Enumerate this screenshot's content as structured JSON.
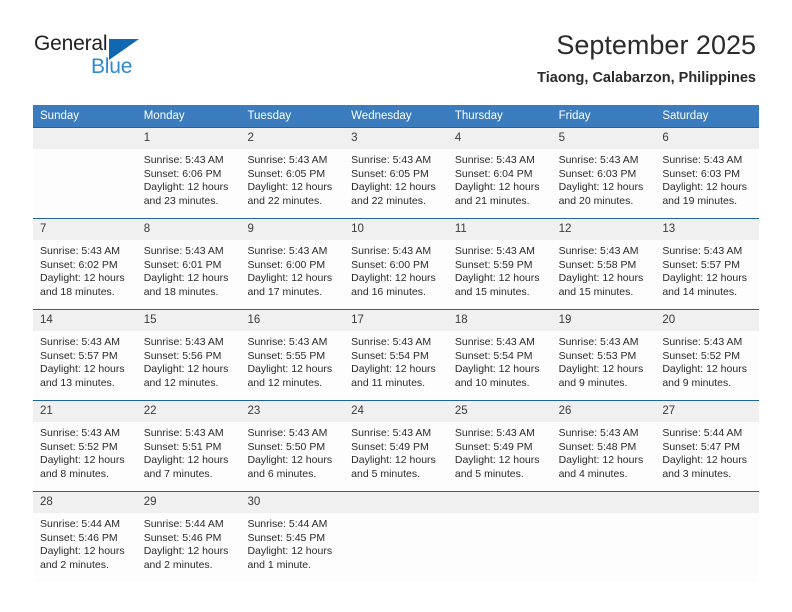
{
  "brand": {
    "name_top": "General",
    "name_bottom": "Blue",
    "triangle_color": "#1167b1",
    "blue_text_color": "#2e8bd4"
  },
  "header": {
    "title": "September 2025",
    "subtitle": "Tiaong, Calabarzon, Philippines"
  },
  "colors": {
    "header_row_bg": "#3b7cbf",
    "header_row_text": "#ffffff",
    "week_divider": "#1f63a4",
    "day_number_band": "#f0f0f0",
    "cell_bg": "#fdfdfd"
  },
  "calendar": {
    "day_headers": [
      "Sunday",
      "Monday",
      "Tuesday",
      "Wednesday",
      "Thursday",
      "Friday",
      "Saturday"
    ],
    "weeks": [
      [
        {
          "day": "",
          "sunrise": "",
          "sunset": "",
          "daylight_line1": "",
          "daylight_line2": ""
        },
        {
          "day": "1",
          "sunrise": "Sunrise: 5:43 AM",
          "sunset": "Sunset: 6:06 PM",
          "daylight_line1": "Daylight: 12 hours",
          "daylight_line2": "and 23 minutes."
        },
        {
          "day": "2",
          "sunrise": "Sunrise: 5:43 AM",
          "sunset": "Sunset: 6:05 PM",
          "daylight_line1": "Daylight: 12 hours",
          "daylight_line2": "and 22 minutes."
        },
        {
          "day": "3",
          "sunrise": "Sunrise: 5:43 AM",
          "sunset": "Sunset: 6:05 PM",
          "daylight_line1": "Daylight: 12 hours",
          "daylight_line2": "and 22 minutes."
        },
        {
          "day": "4",
          "sunrise": "Sunrise: 5:43 AM",
          "sunset": "Sunset: 6:04 PM",
          "daylight_line1": "Daylight: 12 hours",
          "daylight_line2": "and 21 minutes."
        },
        {
          "day": "5",
          "sunrise": "Sunrise: 5:43 AM",
          "sunset": "Sunset: 6:03 PM",
          "daylight_line1": "Daylight: 12 hours",
          "daylight_line2": "and 20 minutes."
        },
        {
          "day": "6",
          "sunrise": "Sunrise: 5:43 AM",
          "sunset": "Sunset: 6:03 PM",
          "daylight_line1": "Daylight: 12 hours",
          "daylight_line2": "and 19 minutes."
        }
      ],
      [
        {
          "day": "7",
          "sunrise": "Sunrise: 5:43 AM",
          "sunset": "Sunset: 6:02 PM",
          "daylight_line1": "Daylight: 12 hours",
          "daylight_line2": "and 18 minutes."
        },
        {
          "day": "8",
          "sunrise": "Sunrise: 5:43 AM",
          "sunset": "Sunset: 6:01 PM",
          "daylight_line1": "Daylight: 12 hours",
          "daylight_line2": "and 18 minutes."
        },
        {
          "day": "9",
          "sunrise": "Sunrise: 5:43 AM",
          "sunset": "Sunset: 6:00 PM",
          "daylight_line1": "Daylight: 12 hours",
          "daylight_line2": "and 17 minutes."
        },
        {
          "day": "10",
          "sunrise": "Sunrise: 5:43 AM",
          "sunset": "Sunset: 6:00 PM",
          "daylight_line1": "Daylight: 12 hours",
          "daylight_line2": "and 16 minutes."
        },
        {
          "day": "11",
          "sunrise": "Sunrise: 5:43 AM",
          "sunset": "Sunset: 5:59 PM",
          "daylight_line1": "Daylight: 12 hours",
          "daylight_line2": "and 15 minutes."
        },
        {
          "day": "12",
          "sunrise": "Sunrise: 5:43 AM",
          "sunset": "Sunset: 5:58 PM",
          "daylight_line1": "Daylight: 12 hours",
          "daylight_line2": "and 15 minutes."
        },
        {
          "day": "13",
          "sunrise": "Sunrise: 5:43 AM",
          "sunset": "Sunset: 5:57 PM",
          "daylight_line1": "Daylight: 12 hours",
          "daylight_line2": "and 14 minutes."
        }
      ],
      [
        {
          "day": "14",
          "sunrise": "Sunrise: 5:43 AM",
          "sunset": "Sunset: 5:57 PM",
          "daylight_line1": "Daylight: 12 hours",
          "daylight_line2": "and 13 minutes."
        },
        {
          "day": "15",
          "sunrise": "Sunrise: 5:43 AM",
          "sunset": "Sunset: 5:56 PM",
          "daylight_line1": "Daylight: 12 hours",
          "daylight_line2": "and 12 minutes."
        },
        {
          "day": "16",
          "sunrise": "Sunrise: 5:43 AM",
          "sunset": "Sunset: 5:55 PM",
          "daylight_line1": "Daylight: 12 hours",
          "daylight_line2": "and 12 minutes."
        },
        {
          "day": "17",
          "sunrise": "Sunrise: 5:43 AM",
          "sunset": "Sunset: 5:54 PM",
          "daylight_line1": "Daylight: 12 hours",
          "daylight_line2": "and 11 minutes."
        },
        {
          "day": "18",
          "sunrise": "Sunrise: 5:43 AM",
          "sunset": "Sunset: 5:54 PM",
          "daylight_line1": "Daylight: 12 hours",
          "daylight_line2": "and 10 minutes."
        },
        {
          "day": "19",
          "sunrise": "Sunrise: 5:43 AM",
          "sunset": "Sunset: 5:53 PM",
          "daylight_line1": "Daylight: 12 hours",
          "daylight_line2": "and 9 minutes."
        },
        {
          "day": "20",
          "sunrise": "Sunrise: 5:43 AM",
          "sunset": "Sunset: 5:52 PM",
          "daylight_line1": "Daylight: 12 hours",
          "daylight_line2": "and 9 minutes."
        }
      ],
      [
        {
          "day": "21",
          "sunrise": "Sunrise: 5:43 AM",
          "sunset": "Sunset: 5:52 PM",
          "daylight_line1": "Daylight: 12 hours",
          "daylight_line2": "and 8 minutes."
        },
        {
          "day": "22",
          "sunrise": "Sunrise: 5:43 AM",
          "sunset": "Sunset: 5:51 PM",
          "daylight_line1": "Daylight: 12 hours",
          "daylight_line2": "and 7 minutes."
        },
        {
          "day": "23",
          "sunrise": "Sunrise: 5:43 AM",
          "sunset": "Sunset: 5:50 PM",
          "daylight_line1": "Daylight: 12 hours",
          "daylight_line2": "and 6 minutes."
        },
        {
          "day": "24",
          "sunrise": "Sunrise: 5:43 AM",
          "sunset": "Sunset: 5:49 PM",
          "daylight_line1": "Daylight: 12 hours",
          "daylight_line2": "and 5 minutes."
        },
        {
          "day": "25",
          "sunrise": "Sunrise: 5:43 AM",
          "sunset": "Sunset: 5:49 PM",
          "daylight_line1": "Daylight: 12 hours",
          "daylight_line2": "and 5 minutes."
        },
        {
          "day": "26",
          "sunrise": "Sunrise: 5:43 AM",
          "sunset": "Sunset: 5:48 PM",
          "daylight_line1": "Daylight: 12 hours",
          "daylight_line2": "and 4 minutes."
        },
        {
          "day": "27",
          "sunrise": "Sunrise: 5:44 AM",
          "sunset": "Sunset: 5:47 PM",
          "daylight_line1": "Daylight: 12 hours",
          "daylight_line2": "and 3 minutes."
        }
      ],
      [
        {
          "day": "28",
          "sunrise": "Sunrise: 5:44 AM",
          "sunset": "Sunset: 5:46 PM",
          "daylight_line1": "Daylight: 12 hours",
          "daylight_line2": "and 2 minutes."
        },
        {
          "day": "29",
          "sunrise": "Sunrise: 5:44 AM",
          "sunset": "Sunset: 5:46 PM",
          "daylight_line1": "Daylight: 12 hours",
          "daylight_line2": "and 2 minutes."
        },
        {
          "day": "30",
          "sunrise": "Sunrise: 5:44 AM",
          "sunset": "Sunset: 5:45 PM",
          "daylight_line1": "Daylight: 12 hours",
          "daylight_line2": "and 1 minute."
        },
        {
          "day": "",
          "sunrise": "",
          "sunset": "",
          "daylight_line1": "",
          "daylight_line2": ""
        },
        {
          "day": "",
          "sunrise": "",
          "sunset": "",
          "daylight_line1": "",
          "daylight_line2": ""
        },
        {
          "day": "",
          "sunrise": "",
          "sunset": "",
          "daylight_line1": "",
          "daylight_line2": ""
        },
        {
          "day": "",
          "sunrise": "",
          "sunset": "",
          "daylight_line1": "",
          "daylight_line2": ""
        }
      ]
    ]
  }
}
